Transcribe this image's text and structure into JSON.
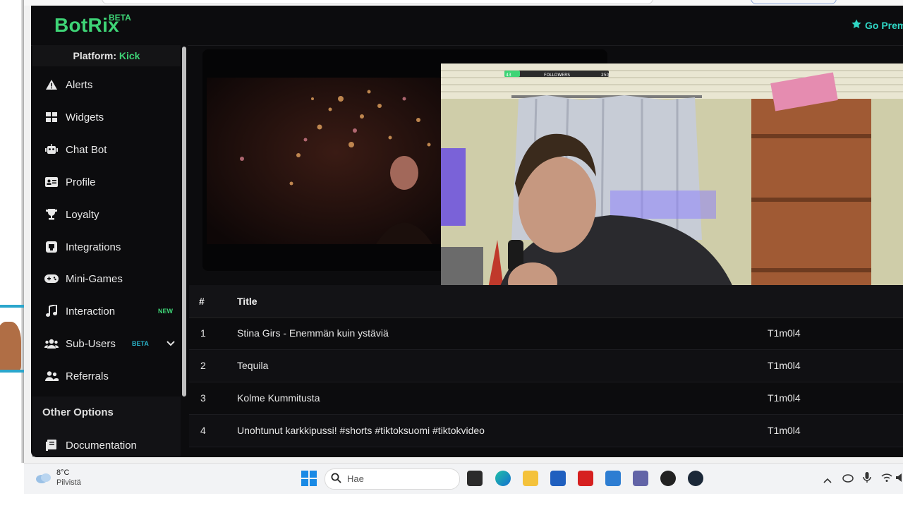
{
  "app": {
    "logo": "BotRix",
    "logo_badge": "BETA",
    "premium_label": "Go Prem"
  },
  "sidebar": {
    "platform_label": "Platform:",
    "platform_value": "Kick",
    "items": [
      {
        "label": "Alerts",
        "icon": "warning-icon"
      },
      {
        "label": "Widgets",
        "icon": "grid-icon"
      },
      {
        "label": "Chat Bot",
        "icon": "robot-icon"
      },
      {
        "label": "Profile",
        "icon": "id-card-icon"
      },
      {
        "label": "Loyalty",
        "icon": "trophy-icon"
      },
      {
        "label": "Integrations",
        "icon": "plug-icon"
      },
      {
        "label": "Mini-Games",
        "icon": "gamepad-icon"
      },
      {
        "label": "Interaction",
        "icon": "music-icon",
        "badge": "NEW"
      },
      {
        "label": "Sub-Users",
        "icon": "users-icon",
        "badge": "BETA"
      },
      {
        "label": "Referrals",
        "icon": "user-friends-icon"
      }
    ],
    "other_options_heading": "Other Options",
    "other_items": [
      {
        "label": "Documentation",
        "icon": "book-icon"
      }
    ]
  },
  "overlay": {
    "followers_label": "FOLLOWERS",
    "followers_left": "43",
    "followers_right": "250"
  },
  "table": {
    "headers": {
      "num": "#",
      "title": "Title"
    },
    "rows": [
      {
        "num": "1",
        "title": "Stina Girs - Enemmän kuin ystäviä",
        "user": "T1m0l4"
      },
      {
        "num": "2",
        "title": "Tequila",
        "user": "T1m0l4"
      },
      {
        "num": "3",
        "title": "Kolme Kummitusta",
        "user": "T1m0l4"
      },
      {
        "num": "4",
        "title": "Unohtunut karkkipussi! #shorts #tiktoksuomi #tiktokvideo",
        "user": "T1m0l4"
      }
    ]
  },
  "taskbar": {
    "weather_temp": "8°C",
    "weather_desc": "Pilvistä",
    "search_placeholder": "Hae"
  },
  "colors": {
    "brand_green": "#3ed476",
    "premium_teal": "#2fd6c4",
    "beta_teal": "#2ab3c9",
    "background": "#0c0c0e"
  }
}
